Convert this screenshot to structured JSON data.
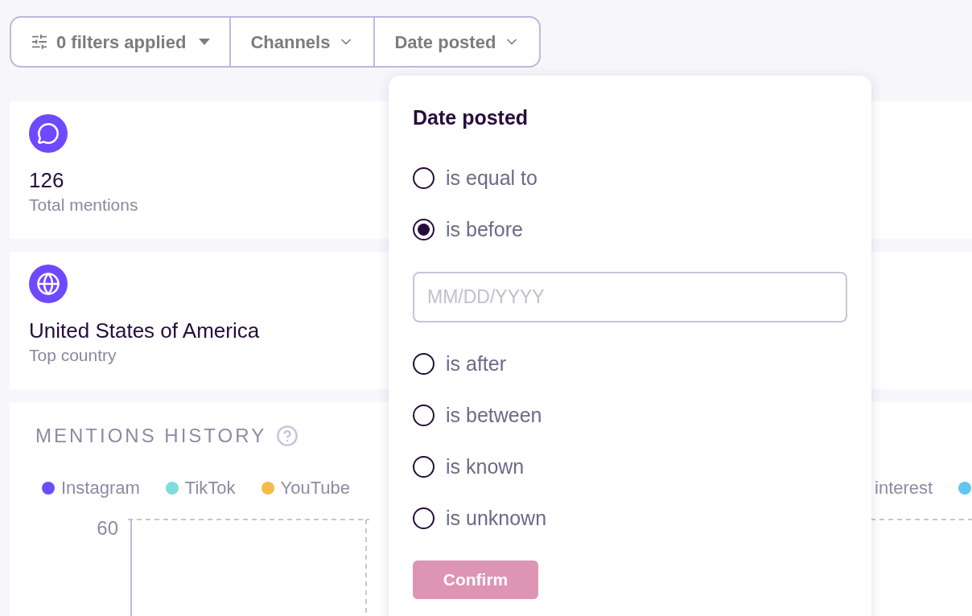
{
  "filter_bar": {
    "items": [
      {
        "kind": "summary",
        "label": "0 filters applied"
      },
      {
        "kind": "dropdown",
        "label": "Channels"
      },
      {
        "kind": "dropdown",
        "label": "Date posted"
      }
    ]
  },
  "stats": [
    {
      "kind": "mentions",
      "value": "126",
      "label": "Total mentions"
    },
    {
      "kind": "country",
      "value": "United States of America",
      "label": "Top country"
    }
  ],
  "mentions_history": {
    "title": "MENTIONS HISTORY",
    "legend": [
      {
        "label": "Instagram",
        "color": "#6a4ff7"
      },
      {
        "label": "TikTok",
        "color": "#7fdcdc"
      },
      {
        "label": "YouTube",
        "color": "#f5bb48"
      },
      {
        "label": "interest"
      },
      {
        "color": "#62c6f2"
      }
    ],
    "y_tick_label": "60"
  },
  "popover": {
    "title": "Date posted",
    "options": [
      {
        "label": "is equal to",
        "selected": false
      },
      {
        "label": "is before",
        "selected": true
      },
      {
        "label": "is after",
        "selected": false
      },
      {
        "label": "is between",
        "selected": false
      },
      {
        "label": "is known",
        "selected": false
      },
      {
        "label": "is unknown",
        "selected": false
      }
    ],
    "date_input": {
      "placeholder": "MM/DD/YYYY"
    },
    "confirm": {
      "label": "Confirm",
      "disabled": true
    }
  }
}
